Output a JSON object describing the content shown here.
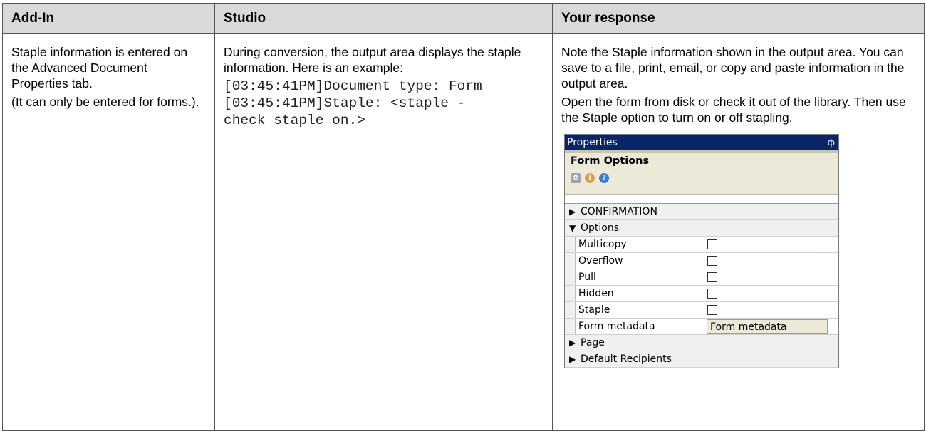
{
  "columns": [
    "Add-In",
    "Studio",
    "Your response"
  ],
  "addin": {
    "p1": "Staple information is entered on the Advanced Document Properties tab.",
    "p2": "(It can only be entered for forms.)."
  },
  "studio": {
    "p1": "During conversion, the output area displays the staple information. Here is an example:",
    "code1": "[03:45:41PM]Document type: Form",
    "code2": "[03:45:41PM]Staple: <staple -",
    "code3": "check staple on.>"
  },
  "response": {
    "p1": "Note the Staple information shown in the output area. You can save to a file, print, email, or copy and paste information in the output area.",
    "p2": "Open the form from disk or check it out of the library. Then use the Staple option to turn on or off stapling."
  },
  "panel": {
    "title": "Properties",
    "pin": "ф",
    "header": "Form Options",
    "toolbar_icons": [
      "print-icon",
      "info-icon",
      "help-icon"
    ],
    "categories": {
      "confirmation": "CONFIRMATION",
      "options": "Options",
      "page": "Page",
      "recipients": "Default Recipients"
    },
    "options": [
      {
        "name": "Multicopy"
      },
      {
        "name": "Overflow"
      },
      {
        "name": "Pull"
      },
      {
        "name": "Hidden"
      },
      {
        "name": "Staple"
      }
    ],
    "metadata": {
      "name": "Form metadata",
      "value": "Form metadata"
    }
  }
}
